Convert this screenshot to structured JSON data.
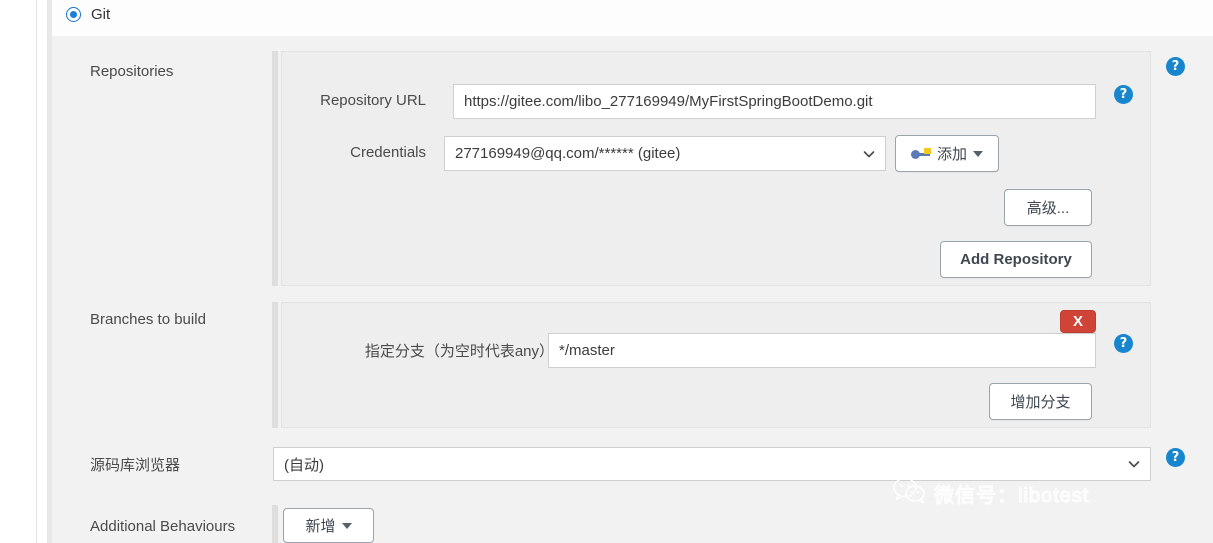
{
  "scm": {
    "selected_option": "Git",
    "radio_icon": "radio-selected-icon"
  },
  "repositories": {
    "section_label": "Repositories",
    "url_label": "Repository URL",
    "url_value": "https://gitee.com/libo_277169949/MyFirstSpringBootDemo.git",
    "credentials_label": "Credentials",
    "credentials_value": "277169949@qq.com/****** (gitee)",
    "credentials_caret_icon": "chevron-down-icon",
    "add_credentials_label": "添加",
    "add_credentials_icon": "key-icon",
    "add_credentials_caret_icon": "caret-down-icon",
    "advanced_label": "高级...",
    "add_repository_label": "Add Repository",
    "help_icon": "help-icon",
    "help_glyph": "?"
  },
  "branches": {
    "section_label": "Branches to build",
    "spec_label": "指定分支（为空时代表any）",
    "spec_value": "*/master",
    "delete_label": "X",
    "add_branch_label": "增加分支",
    "help_icon": "help-icon",
    "help_glyph": "?"
  },
  "browser": {
    "label": "源码库浏览器",
    "value": "(自动)",
    "caret_icon": "chevron-down-icon",
    "help_icon": "help-icon",
    "help_glyph": "?"
  },
  "additional_behaviours": {
    "label": "Additional Behaviours",
    "add_label": "新增",
    "caret_icon": "caret-down-icon"
  },
  "watermark": {
    "text": "微信号：libotest",
    "logo_icon": "wechat-logo-icon"
  },
  "colors": {
    "accent_blue": "#1786cf",
    "radio_blue": "#1b7fd6",
    "danger_red": "#cf4436",
    "panel_bg": "#f2f2f2",
    "block_bg": "#eeeeee",
    "button_border": "#9aa4ad"
  }
}
